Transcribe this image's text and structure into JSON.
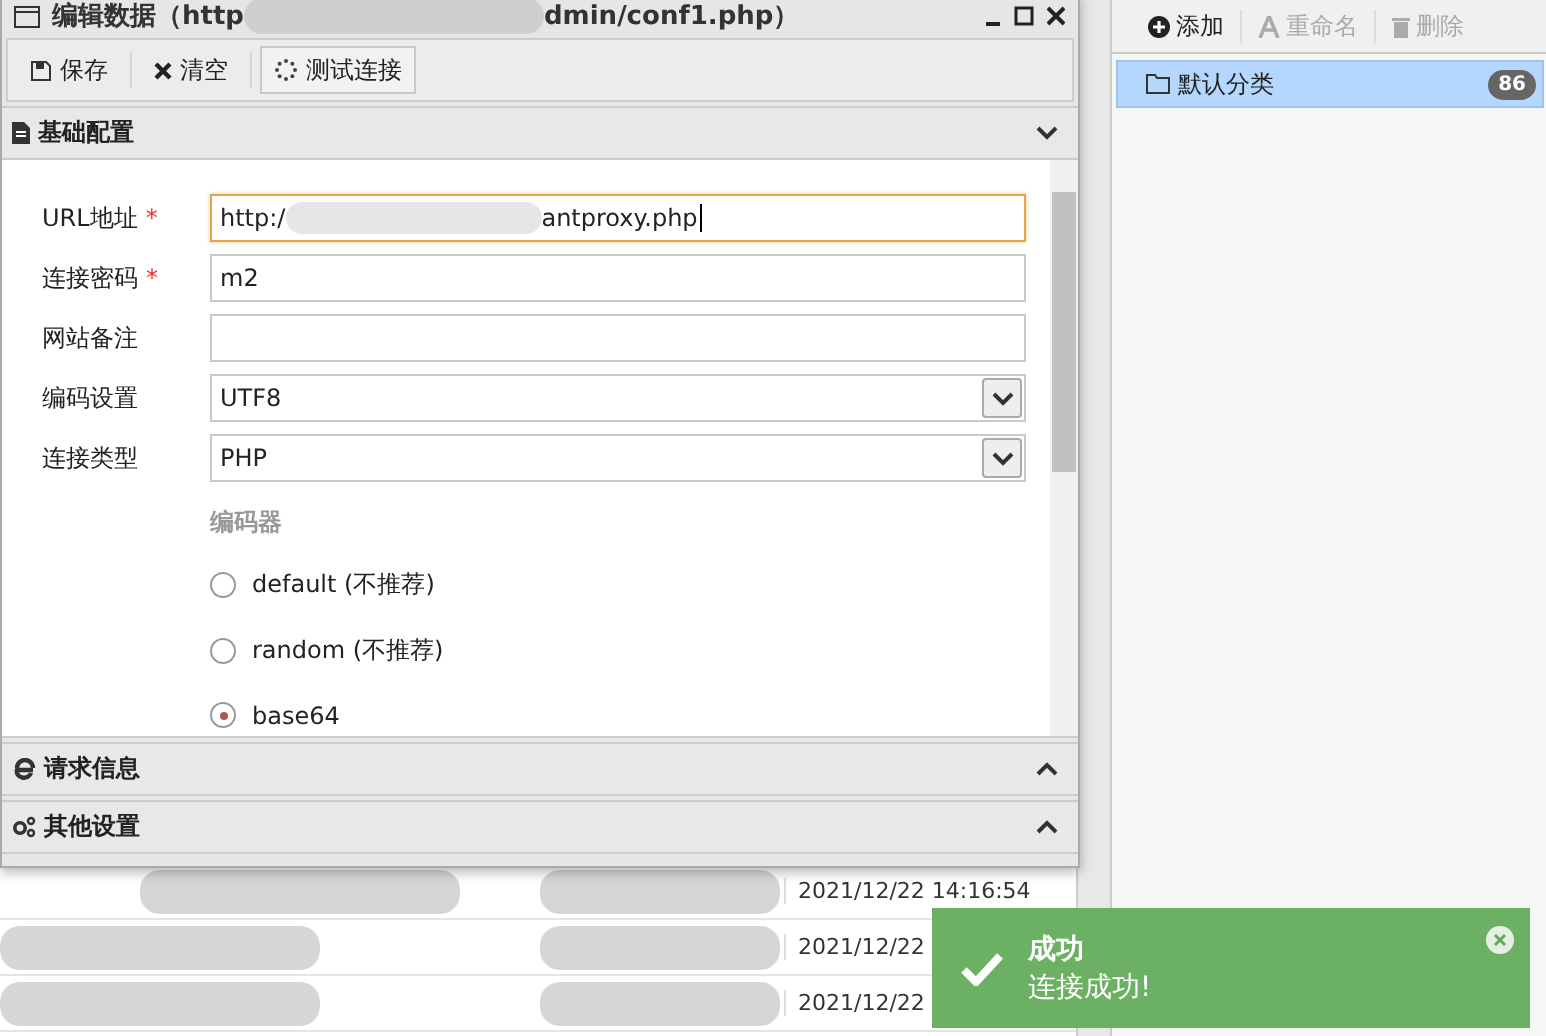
{
  "window": {
    "title_start": "编辑数据（http",
    "title_end": "dmin/conf1.php）"
  },
  "toolbar": [
    {
      "kind": "save",
      "label": "保存"
    },
    {
      "kind": "clear",
      "label": "清空"
    },
    {
      "kind": "test",
      "label": "测试连接"
    }
  ],
  "sections": [
    {
      "kind": "doc",
      "title": "基础配置",
      "expanded": true
    },
    {
      "kind": "ie",
      "title": "请求信息",
      "expanded": false
    },
    {
      "kind": "gears",
      "title": "其他设置",
      "expanded": false
    }
  ],
  "form": {
    "fields": [
      {
        "kind": "text",
        "label": "URL地址",
        "required_mark": "*",
        "focused": true,
        "value_start": "http:/",
        "value_end": "antproxy.php"
      },
      {
        "kind": "text",
        "label": "连接密码",
        "required_mark": "*",
        "focused": false,
        "value_start": "m2"
      },
      {
        "kind": "text",
        "label": "网站备注",
        "focused": false
      },
      {
        "kind": "select",
        "label": "编码设置",
        "focused": false,
        "value_start": "UTF8"
      },
      {
        "kind": "select",
        "label": "连接类型",
        "focused": false,
        "value_start": "PHP"
      }
    ],
    "encoder": {
      "title": "编码器",
      "options": [
        {
          "label": "default (不推荐)",
          "selected": false
        },
        {
          "label": "random (不推荐)",
          "selected": false
        },
        {
          "label": "base64",
          "selected": true
        }
      ]
    }
  },
  "categories": {
    "toolbar": [
      {
        "kind": "add",
        "label": "添加",
        "disabled": false
      },
      {
        "kind": "rename",
        "label": "重命名",
        "disabled": true
      },
      {
        "kind": "delete",
        "label": "删除",
        "disabled": true
      }
    ],
    "items": [
      {
        "label": "默认分类",
        "count": "86",
        "selected": true
      }
    ]
  },
  "table": {
    "rows": [
      {
        "column_4": "2021/12/22 14:16:54"
      },
      {
        "column_4": "2021/12/22"
      },
      {
        "column_4": "2021/12/22"
      }
    ]
  },
  "toast": {
    "title": "成功",
    "message": "连接成功!"
  }
}
